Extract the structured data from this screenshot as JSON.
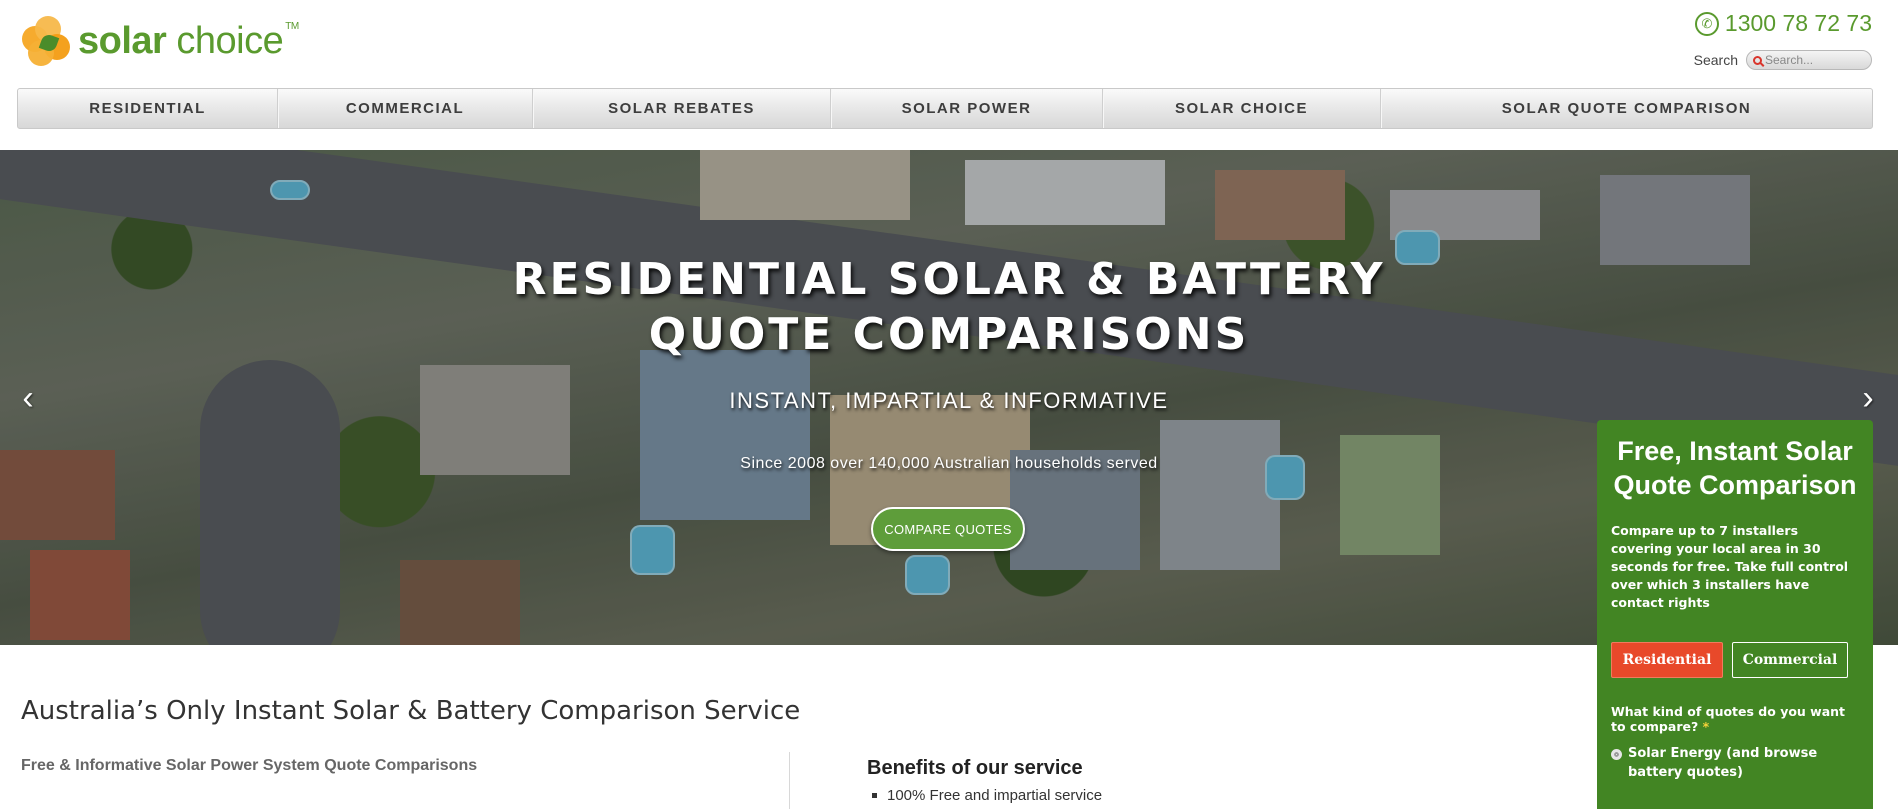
{
  "brand": {
    "name_bold": "solar",
    "name_light": " choice",
    "tm": "TM"
  },
  "contact": {
    "phone": "1300 78 72 73"
  },
  "search": {
    "label": "Search",
    "placeholder": "Search..."
  },
  "nav": {
    "items": [
      {
        "label": "RESIDENTIAL"
      },
      {
        "label": "COMMERCIAL"
      },
      {
        "label": "SOLAR REBATES"
      },
      {
        "label": "SOLAR POWER"
      },
      {
        "label": "SOLAR CHOICE"
      },
      {
        "label": "SOLAR QUOTE COMPARISON"
      }
    ]
  },
  "hero": {
    "title_line1": "RESIDENTIAL SOLAR & BATTERY",
    "title_line2": "QUOTE COMPARISONS",
    "subtitle": "INSTANT, IMPARTIAL & INFORMATIVE",
    "since": "Since 2008 over 140,000 Australian households served",
    "cta": "COMPARE QUOTES",
    "prev_arrow": "‹",
    "next_arrow": "›"
  },
  "content": {
    "heading": "Australia’s Only Instant Solar & Battery Comparison Service",
    "subheading": "Free & Informative Solar Power System Quote Comparisons",
    "benefits_title": "Benefits of our service",
    "benefits": [
      "100% Free and impartial service"
    ]
  },
  "quote_panel": {
    "title": "Free, Instant Solar Quote Comparison",
    "description": "Compare up to 7 installers covering your local area in 30 seconds for free. Take full control over which 3 installers have contact rights",
    "tab_residential": "Residential",
    "tab_commercial": "Commercial",
    "question": "What kind of quotes do you want to compare?",
    "required_mark": "*",
    "option_1": "Solar Energy (and browse battery quotes)"
  },
  "colors": {
    "brand_green": "#5a9a2e",
    "panel_green": "#428523",
    "cta_green": "#5e9d3a",
    "tab_orange": "#e8492a"
  }
}
